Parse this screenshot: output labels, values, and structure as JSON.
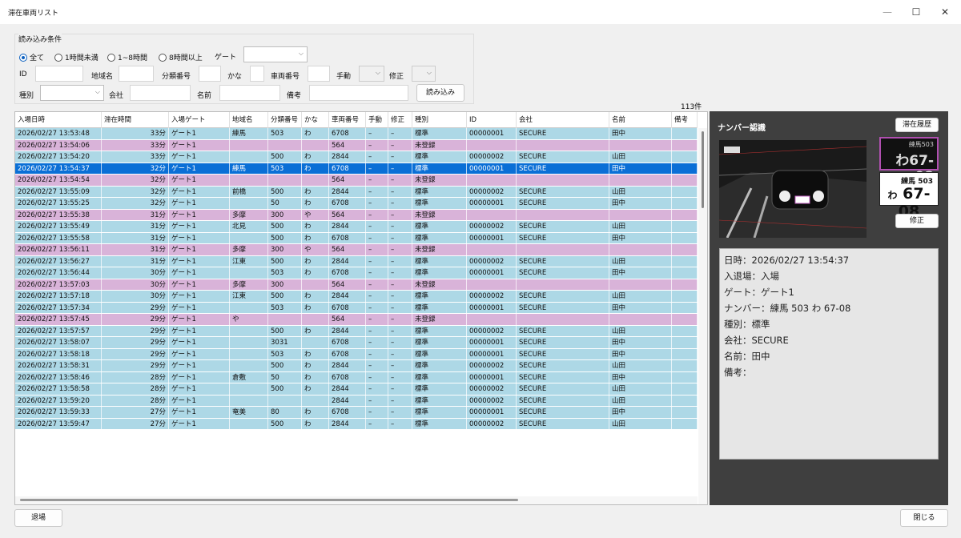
{
  "window": {
    "title": "滞在車両リスト",
    "min": "—",
    "max": "☐",
    "close": "✕"
  },
  "conditions": {
    "group_title": "読み込み条件",
    "radios": [
      "全て",
      "1時間未満",
      "1~8時間",
      "8時間以上"
    ],
    "selected_radio": "全て",
    "gate_label": "ゲート",
    "gate_value": "",
    "id_label": "ID",
    "region_label": "地域名",
    "class_label": "分類番号",
    "kana_label": "かな",
    "number_label": "車両番号",
    "manual_label": "手動",
    "fix_label": "修正",
    "type_label": "種別",
    "company_label": "会社",
    "name_label": "名前",
    "note_label": "備考",
    "load_button": "読み込み"
  },
  "record_count": "113件",
  "grid": {
    "headers": [
      "入場日時",
      "滞在時間",
      "入場ゲート",
      "地域名",
      "分類番号",
      "かな",
      "車両番号",
      "手動",
      "修正",
      "種別",
      "ID",
      "会社",
      "名前",
      "備考"
    ],
    "selected_row": 3,
    "rows": [
      {
        "dt": "2026/02/27 13:53:48",
        "stay": "33分",
        "gate": "ゲート1",
        "region": "練馬",
        "cls": "503",
        "kana": "わ",
        "num": "6708",
        "manual": "–",
        "fix": "–",
        "type": "標準",
        "id": "00000001",
        "company": "SECURE",
        "name": "田中",
        "note": "",
        "kind": "reg"
      },
      {
        "dt": "2026/02/27 13:54:06",
        "stay": "33分",
        "gate": "ゲート1",
        "region": "",
        "cls": "",
        "kana": "",
        "num": "564",
        "manual": "–",
        "fix": "–",
        "type": "未登録",
        "id": "",
        "company": "",
        "name": "",
        "note": "",
        "kind": "unreg"
      },
      {
        "dt": "2026/02/27 13:54:20",
        "stay": "33分",
        "gate": "ゲート1",
        "region": "",
        "cls": "500",
        "kana": "わ",
        "num": "2844",
        "manual": "–",
        "fix": "–",
        "type": "標準",
        "id": "00000002",
        "company": "SECURE",
        "name": "山田",
        "note": "",
        "kind": "reg"
      },
      {
        "dt": "2026/02/27 13:54:37",
        "stay": "32分",
        "gate": "ゲート1",
        "region": "練馬",
        "cls": "503",
        "kana": "わ",
        "num": "6708",
        "manual": "–",
        "fix": "–",
        "type": "標準",
        "id": "00000001",
        "company": "SECURE",
        "name": "田中",
        "note": "",
        "kind": "reg"
      },
      {
        "dt": "2026/02/27 13:54:54",
        "stay": "32分",
        "gate": "ゲート1",
        "region": "",
        "cls": "",
        "kana": "",
        "num": "564",
        "manual": "–",
        "fix": "–",
        "type": "未登録",
        "id": "",
        "company": "",
        "name": "",
        "note": "",
        "kind": "unreg"
      },
      {
        "dt": "2026/02/27 13:55:09",
        "stay": "32分",
        "gate": "ゲート1",
        "region": "前橋",
        "cls": "500",
        "kana": "わ",
        "num": "2844",
        "manual": "–",
        "fix": "–",
        "type": "標準",
        "id": "00000002",
        "company": "SECURE",
        "name": "山田",
        "note": "",
        "kind": "reg"
      },
      {
        "dt": "2026/02/27 13:55:25",
        "stay": "32分",
        "gate": "ゲート1",
        "region": "",
        "cls": "50",
        "kana": "わ",
        "num": "6708",
        "manual": "–",
        "fix": "–",
        "type": "標準",
        "id": "00000001",
        "company": "SECURE",
        "name": "田中",
        "note": "",
        "kind": "reg"
      },
      {
        "dt": "2026/02/27 13:55:38",
        "stay": "31分",
        "gate": "ゲート1",
        "region": "多摩",
        "cls": "300",
        "kana": "や",
        "num": "564",
        "manual": "–",
        "fix": "–",
        "type": "未登録",
        "id": "",
        "company": "",
        "name": "",
        "note": "",
        "kind": "unreg"
      },
      {
        "dt": "2026/02/27 13:55:49",
        "stay": "31分",
        "gate": "ゲート1",
        "region": "北見",
        "cls": "500",
        "kana": "わ",
        "num": "2844",
        "manual": "–",
        "fix": "–",
        "type": "標準",
        "id": "00000002",
        "company": "SECURE",
        "name": "山田",
        "note": "",
        "kind": "reg"
      },
      {
        "dt": "2026/02/27 13:55:58",
        "stay": "31分",
        "gate": "ゲート1",
        "region": "",
        "cls": "500",
        "kana": "わ",
        "num": "6708",
        "manual": "–",
        "fix": "–",
        "type": "標準",
        "id": "00000001",
        "company": "SECURE",
        "name": "田中",
        "note": "",
        "kind": "reg"
      },
      {
        "dt": "2026/02/27 13:56:11",
        "stay": "31分",
        "gate": "ゲート1",
        "region": "多摩",
        "cls": "300",
        "kana": "や",
        "num": "564",
        "manual": "–",
        "fix": "–",
        "type": "未登録",
        "id": "",
        "company": "",
        "name": "",
        "note": "",
        "kind": "unreg"
      },
      {
        "dt": "2026/02/27 13:56:27",
        "stay": "31分",
        "gate": "ゲート1",
        "region": "江東",
        "cls": "500",
        "kana": "わ",
        "num": "2844",
        "manual": "–",
        "fix": "–",
        "type": "標準",
        "id": "00000002",
        "company": "SECURE",
        "name": "山田",
        "note": "",
        "kind": "reg"
      },
      {
        "dt": "2026/02/27 13:56:44",
        "stay": "30分",
        "gate": "ゲート1",
        "region": "",
        "cls": "503",
        "kana": "わ",
        "num": "6708",
        "manual": "–",
        "fix": "–",
        "type": "標準",
        "id": "00000001",
        "company": "SECURE",
        "name": "田中",
        "note": "",
        "kind": "reg"
      },
      {
        "dt": "2026/02/27 13:57:03",
        "stay": "30分",
        "gate": "ゲート1",
        "region": "多摩",
        "cls": "300",
        "kana": "",
        "num": "564",
        "manual": "–",
        "fix": "–",
        "type": "未登録",
        "id": "",
        "company": "",
        "name": "",
        "note": "",
        "kind": "unreg"
      },
      {
        "dt": "2026/02/27 13:57:18",
        "stay": "30分",
        "gate": "ゲート1",
        "region": "江東",
        "cls": "500",
        "kana": "わ",
        "num": "2844",
        "manual": "–",
        "fix": "–",
        "type": "標準",
        "id": "00000002",
        "company": "SECURE",
        "name": "山田",
        "note": "",
        "kind": "reg"
      },
      {
        "dt": "2026/02/27 13:57:34",
        "stay": "29分",
        "gate": "ゲート1",
        "region": "",
        "cls": "503",
        "kana": "わ",
        "num": "6708",
        "manual": "–",
        "fix": "–",
        "type": "標準",
        "id": "00000001",
        "company": "SECURE",
        "name": "田中",
        "note": "",
        "kind": "reg"
      },
      {
        "dt": "2026/02/27 13:57:45",
        "stay": "29分",
        "gate": "ゲート1",
        "region": "や",
        "cls": "",
        "kana": "",
        "num": "564",
        "manual": "–",
        "fix": "–",
        "type": "未登録",
        "id": "",
        "company": "",
        "name": "",
        "note": "",
        "kind": "unreg"
      },
      {
        "dt": "2026/02/27 13:57:57",
        "stay": "29分",
        "gate": "ゲート1",
        "region": "",
        "cls": "500",
        "kana": "わ",
        "num": "2844",
        "manual": "–",
        "fix": "–",
        "type": "標準",
        "id": "00000002",
        "company": "SECURE",
        "name": "山田",
        "note": "",
        "kind": "reg"
      },
      {
        "dt": "2026/02/27 13:58:07",
        "stay": "29分",
        "gate": "ゲート1",
        "region": "",
        "cls": "3031",
        "kana": "",
        "num": "6708",
        "manual": "–",
        "fix": "–",
        "type": "標準",
        "id": "00000001",
        "company": "SECURE",
        "name": "田中",
        "note": "",
        "kind": "reg"
      },
      {
        "dt": "2026/02/27 13:58:18",
        "stay": "29分",
        "gate": "ゲート1",
        "region": "",
        "cls": "503",
        "kana": "わ",
        "num": "6708",
        "manual": "–",
        "fix": "–",
        "type": "標準",
        "id": "00000001",
        "company": "SECURE",
        "name": "田中",
        "note": "",
        "kind": "reg"
      },
      {
        "dt": "2026/02/27 13:58:31",
        "stay": "29分",
        "gate": "ゲート1",
        "region": "",
        "cls": "500",
        "kana": "わ",
        "num": "2844",
        "manual": "–",
        "fix": "–",
        "type": "標準",
        "id": "00000002",
        "company": "SECURE",
        "name": "山田",
        "note": "",
        "kind": "reg"
      },
      {
        "dt": "2026/02/27 13:58:46",
        "stay": "28分",
        "gate": "ゲート1",
        "region": "倉敷",
        "cls": "50",
        "kana": "わ",
        "num": "6708",
        "manual": "–",
        "fix": "–",
        "type": "標準",
        "id": "00000001",
        "company": "SECURE",
        "name": "田中",
        "note": "",
        "kind": "reg"
      },
      {
        "dt": "2026/02/27 13:58:58",
        "stay": "28分",
        "gate": "ゲート1",
        "region": "",
        "cls": "500",
        "kana": "わ",
        "num": "2844",
        "manual": "–",
        "fix": "–",
        "type": "標準",
        "id": "00000002",
        "company": "SECURE",
        "name": "山田",
        "note": "",
        "kind": "reg"
      },
      {
        "dt": "2026/02/27 13:59:20",
        "stay": "28分",
        "gate": "ゲート1",
        "region": "",
        "cls": "",
        "kana": "",
        "num": "2844",
        "manual": "–",
        "fix": "–",
        "type": "標準",
        "id": "00000002",
        "company": "SECURE",
        "name": "山田",
        "note": "",
        "kind": "reg"
      },
      {
        "dt": "2026/02/27 13:59:33",
        "stay": "27分",
        "gate": "ゲート1",
        "region": "奄美",
        "cls": "80",
        "kana": "わ",
        "num": "6708",
        "manual": "–",
        "fix": "–",
        "type": "標準",
        "id": "00000001",
        "company": "SECURE",
        "name": "田中",
        "note": "",
        "kind": "reg"
      },
      {
        "dt": "2026/02/27 13:59:47",
        "stay": "27分",
        "gate": "ゲート1",
        "region": "",
        "cls": "500",
        "kana": "わ",
        "num": "2844",
        "manual": "–",
        "fix": "–",
        "type": "標準",
        "id": "00000002",
        "company": "SECURE",
        "name": "山田",
        "note": "",
        "kind": "reg"
      }
    ]
  },
  "panel": {
    "title": "ナンバー認識",
    "history_button": "滞在履歴",
    "fix_button": "修正",
    "camera_plate_text": "練馬 503",
    "thumb_plate_top": "練馬503",
    "thumb_plate_bottom": "わ67-08",
    "read_top": "練馬 503",
    "read_kana": "わ",
    "read_num": "67-08",
    "info": [
      "日時：2026/02/27 13:54:37",
      "入退場：入場",
      "ゲート：ゲート1",
      "ナンバー：練馬 503 わ 67-08",
      "種別：標準",
      "会社：SECURE",
      "名前：田中",
      "備考："
    ]
  },
  "footer": {
    "exit_button": "退場",
    "close_button": "閉じる"
  },
  "colors": {
    "registered_row": "#add8e6",
    "unregistered_row": "#d9b3d9",
    "selected_row": "#0a6fd6",
    "panel_bg": "#3f3f3f"
  }
}
